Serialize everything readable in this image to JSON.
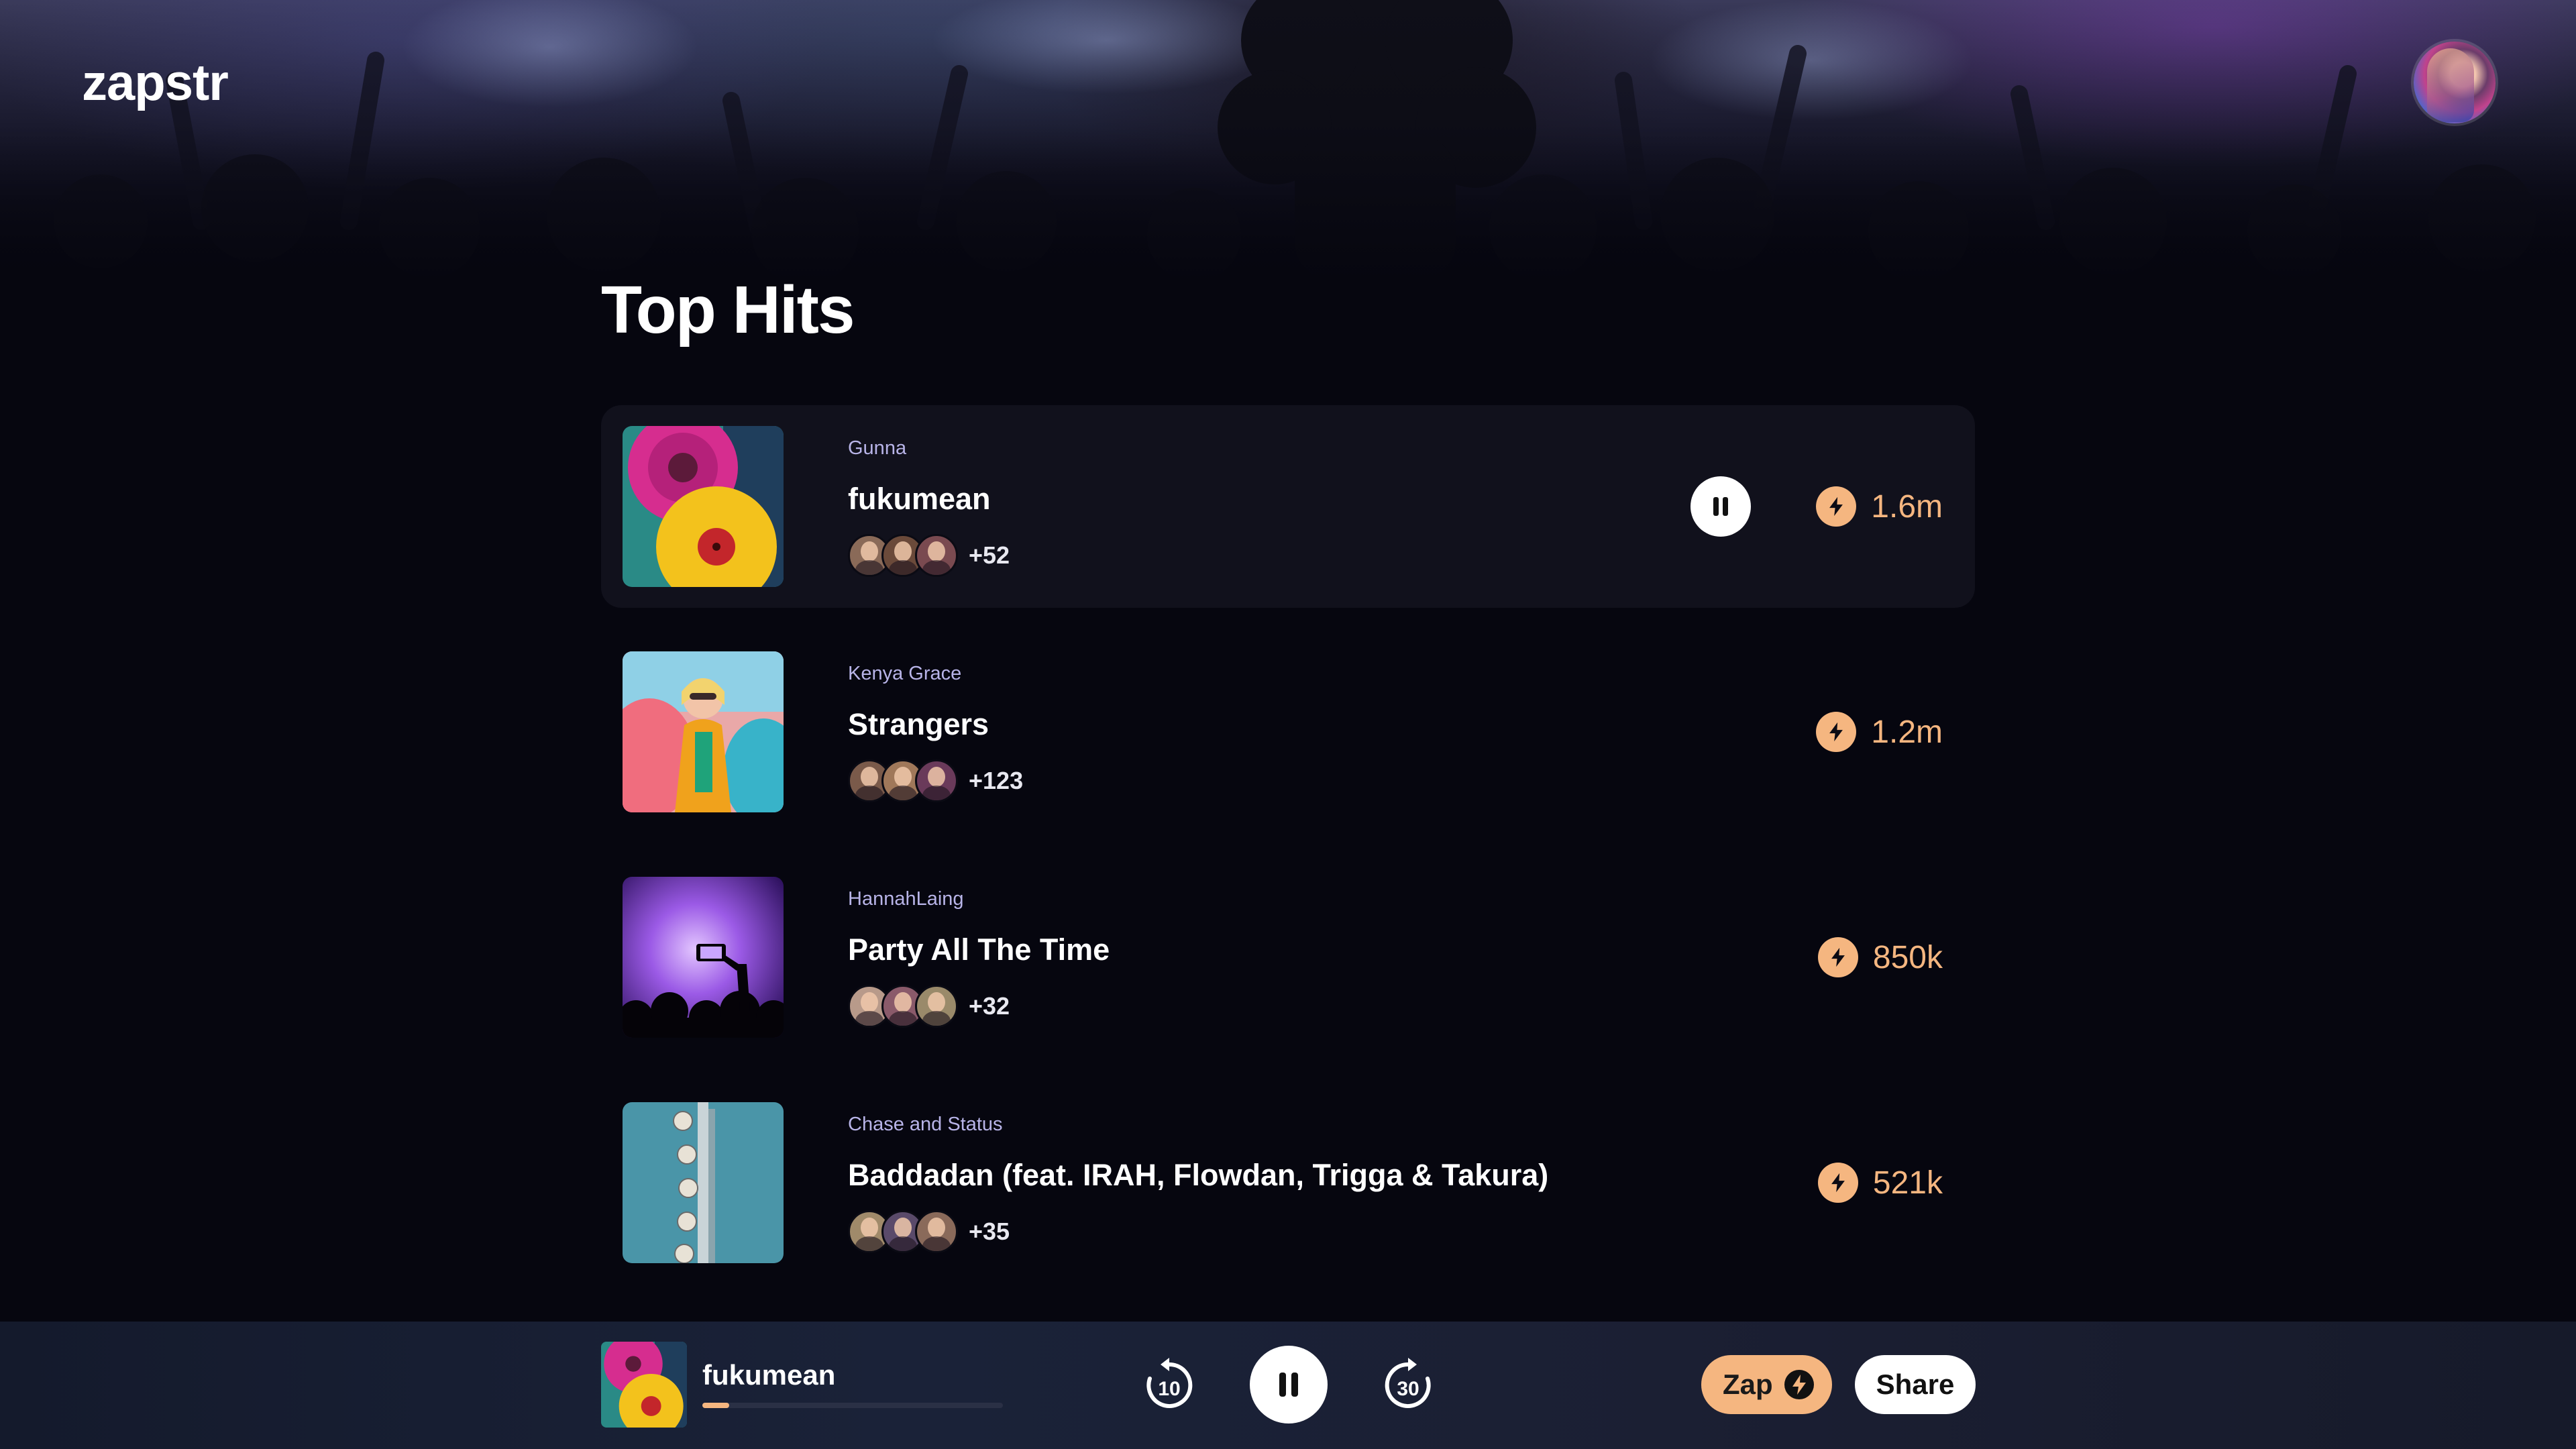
{
  "app": {
    "logo": "zapstr"
  },
  "page": {
    "title": "Top Hits"
  },
  "tracks": [
    {
      "artist": "Gunna",
      "title": "fukumean",
      "fans_more": "+52",
      "zaps": "1.6m",
      "playing": true
    },
    {
      "artist": "Kenya Grace",
      "title": "Strangers",
      "fans_more": "+123",
      "zaps": "1.2m",
      "playing": false
    },
    {
      "artist": "HannahLaing",
      "title": "Party All The Time",
      "fans_more": "+32",
      "zaps": "850k",
      "playing": false
    },
    {
      "artist": "Chase and Status",
      "title": "Baddadan (feat. IRAH, Flowdan, Trigga & Takura)",
      "fans_more": "+35",
      "zaps": "521k",
      "playing": false
    }
  ],
  "player": {
    "title": "fukumean",
    "progress": 0.09,
    "rewind_label": "10",
    "forward_label": "30",
    "zap_label": "Zap",
    "share_label": "Share"
  },
  "icons": {
    "bolt": "lightning-bolt-icon",
    "pause": "pause-icon",
    "rewind": "rewind-10-icon",
    "forward": "forward-30-icon"
  },
  "colors": {
    "background": "#06060f",
    "accent": "#f5b680",
    "artist_text": "#b8b4e8",
    "active_row": "#11111c"
  }
}
